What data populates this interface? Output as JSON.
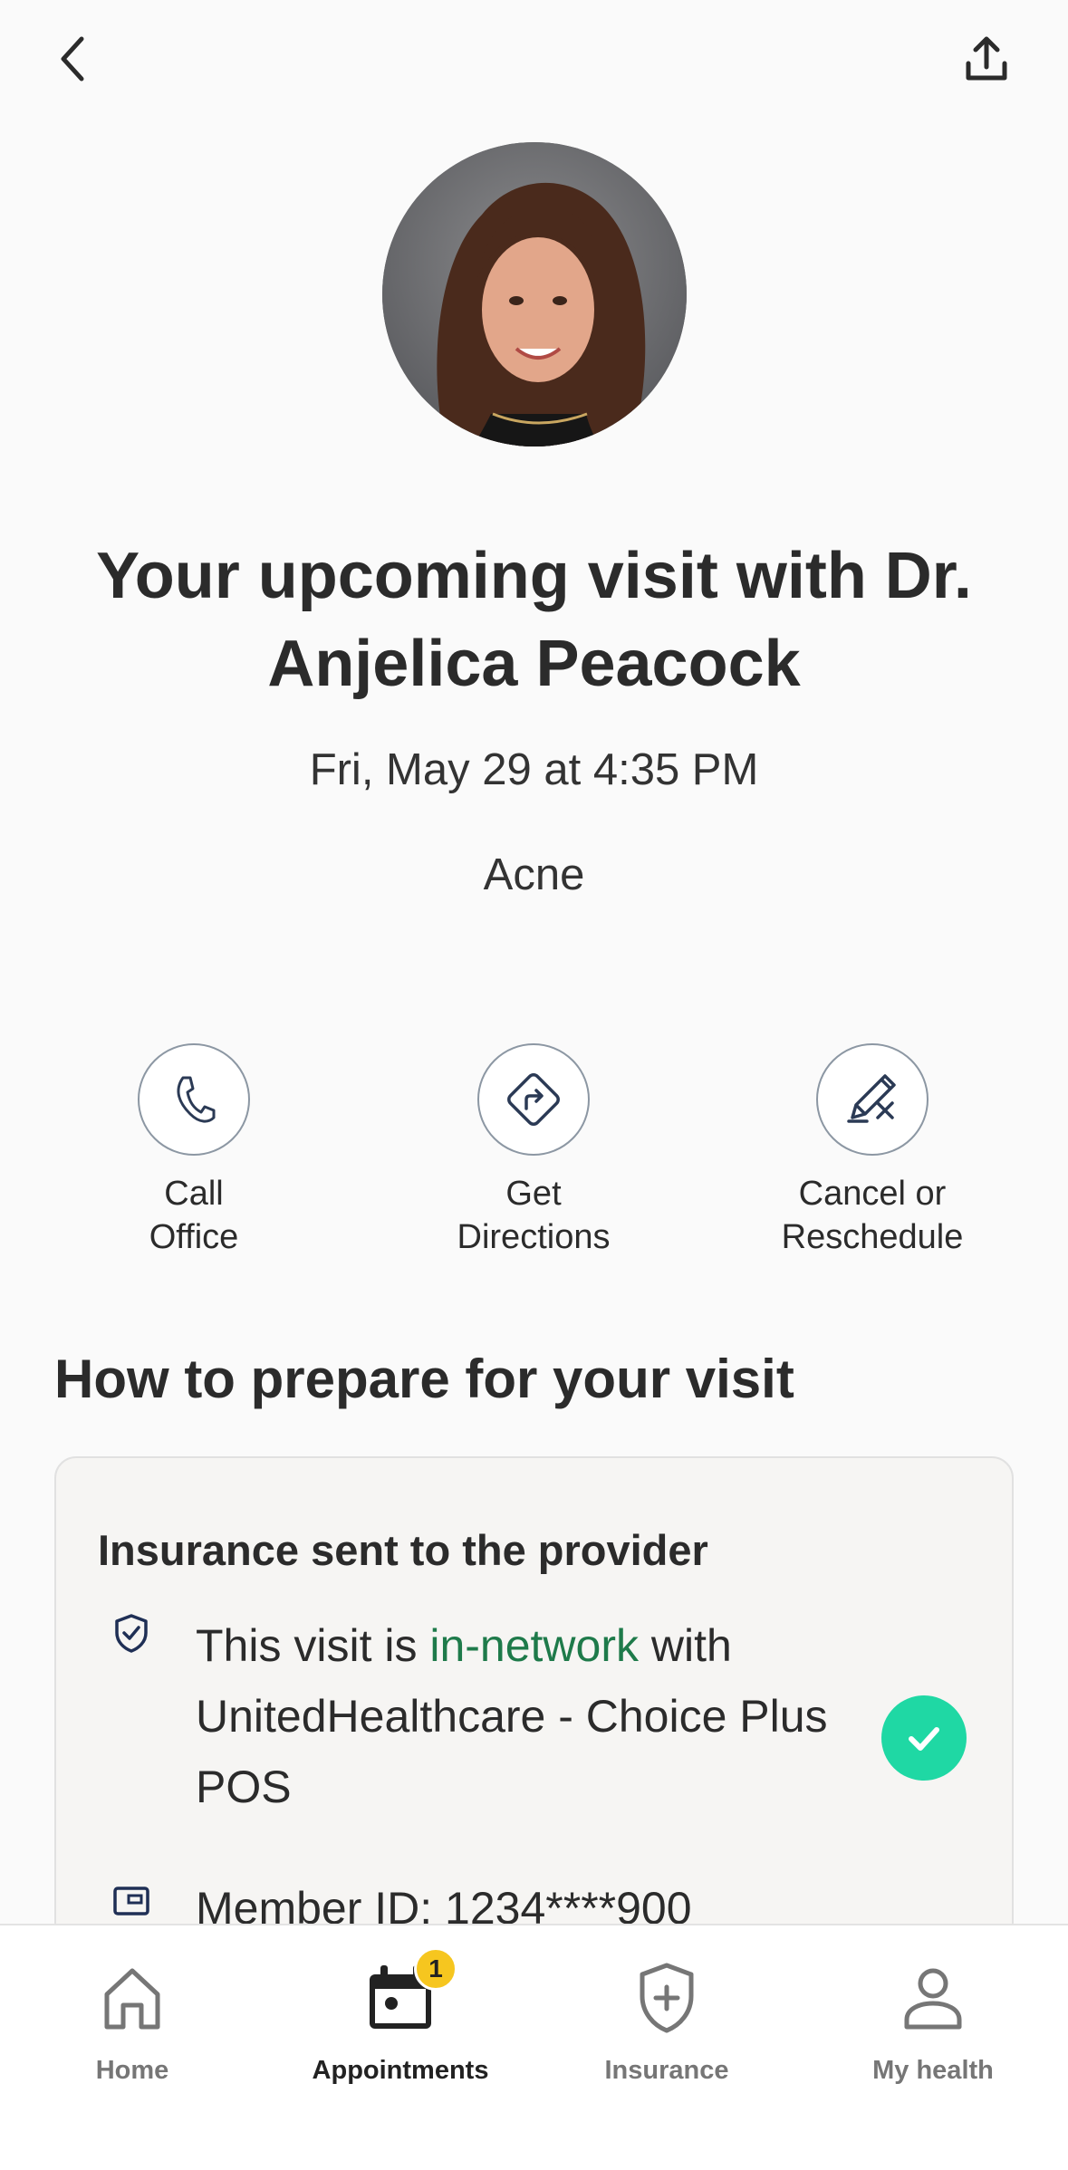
{
  "header": {
    "back_icon": "chevron-left-icon",
    "share_icon": "share-upload-icon"
  },
  "doctor": {
    "avatar": "doctor-photo"
  },
  "visit": {
    "title": "Your upcoming visit with Dr. Anjelica Peacock",
    "datetime": "Fri, May 29 at 4:35 PM",
    "reason": "Acne"
  },
  "actions": [
    {
      "icon": "phone-icon",
      "label_line1": "Call",
      "label_line2": "Office"
    },
    {
      "icon": "directions-icon",
      "label_line1": "Get",
      "label_line2": "Directions"
    },
    {
      "icon": "edit-pencil-icon",
      "label_line1": "Cancel or",
      "label_line2": "Reschedule"
    }
  ],
  "prepare": {
    "section_title": "How to prepare for your visit",
    "card_title": "Insurance sent to the provider",
    "network_prefix": "This visit is ",
    "network_status": "in-network",
    "network_suffix": " with",
    "plan_name": "UnitedHealthcare - Choice Plus POS",
    "member_id": "Member ID:  1234****900",
    "status_color": "#1fd8a4",
    "highlight_color": "#1e7a4a"
  },
  "tabbar": {
    "tabs": [
      {
        "icon": "home-icon",
        "label": "Home"
      },
      {
        "icon": "calendar-icon",
        "label": "Appointments",
        "badge": "1"
      },
      {
        "icon": "shield-plus-icon",
        "label": "Insurance"
      },
      {
        "icon": "person-icon",
        "label": "My health"
      }
    ],
    "active": "Appointments"
  }
}
